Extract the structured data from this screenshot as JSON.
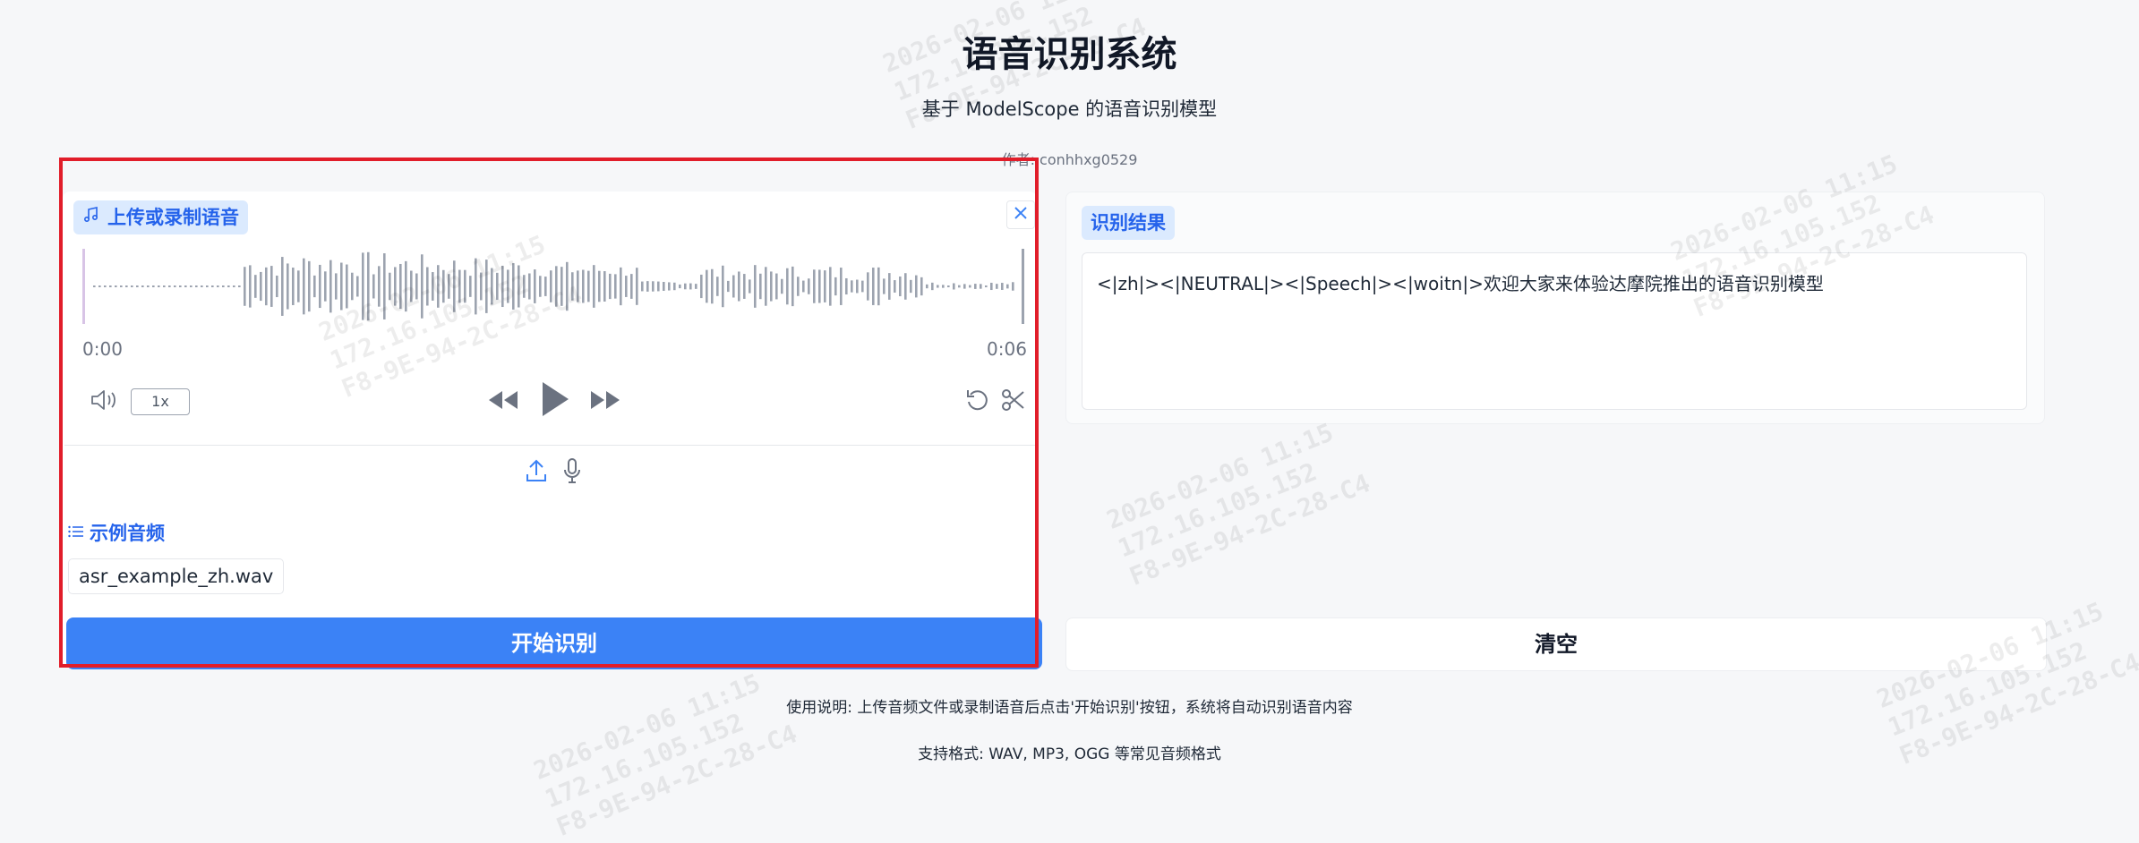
{
  "header": {
    "title": "语音识别系统",
    "subtitle": "基于 ModelScope 的语音识别模型",
    "author": "作者: conhhxg0529"
  },
  "audio_panel": {
    "label": "上传或录制语音",
    "time_start": "0:00",
    "time_end": "0:06",
    "speed": "1x",
    "icons": {
      "label": "music-note-icon",
      "close": "close-icon",
      "volume": "volume-icon",
      "rewind": "rewind-icon",
      "play": "play-icon",
      "forward": "fast-forward-icon",
      "reset": "undo-icon",
      "trim": "scissors-icon",
      "upload": "upload-icon",
      "microphone": "microphone-icon"
    }
  },
  "examples": {
    "label": "示例音频",
    "items": [
      "asr_example_zh.wav"
    ]
  },
  "result": {
    "label": "识别结果",
    "text": "<|zh|><|NEUTRAL|><|Speech|><|woitn|>欢迎大家来体验达摩院推出的语音识别模型"
  },
  "buttons": {
    "start": "开始识别",
    "clear": "清空"
  },
  "footer": {
    "instructions": "使用说明: 上传音频文件或录制语音后点击'开始识别'按钮，系统将自动识别语音内容",
    "formats": "支持格式: WAV, MP3, OGG 等常见音频格式"
  },
  "watermark": {
    "line1": "2026-02-06 11:15",
    "line2": "172.16.105.152",
    "line3": "F8-9E-94-2C-28-C4"
  },
  "colors": {
    "accent": "#3b82f6",
    "label_bg": "#dbeafe",
    "highlight": "#e11d2a",
    "waveform": "#9ca3af"
  }
}
